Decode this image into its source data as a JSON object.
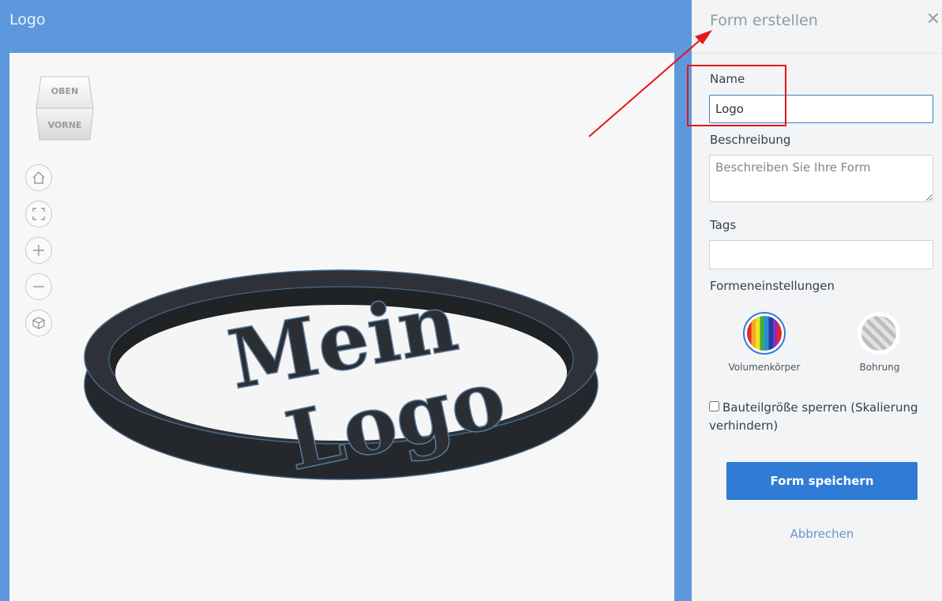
{
  "workspace": {
    "title": "Logo"
  },
  "viewcube": {
    "top_label": "OBEN",
    "front_label": "VORNE"
  },
  "view_controls": [
    {
      "name": "home-view-icon"
    },
    {
      "name": "fit-view-icon"
    },
    {
      "name": "zoom-in-icon"
    },
    {
      "name": "zoom-out-icon"
    },
    {
      "name": "perspective-icon"
    }
  ],
  "model": {
    "line1": "Mein",
    "line2": "Logo"
  },
  "panel": {
    "title": "Form erstellen",
    "close_icon": "close-icon",
    "name_label": "Name",
    "name_value": "Logo",
    "description_label": "Beschreibung",
    "description_placeholder": "Beschreiben Sie Ihre Form",
    "tags_label": "Tags",
    "tags_value": "",
    "settings_label": "Formeneinstellungen",
    "shape_options": [
      {
        "label": "Volumenkörper",
        "selected": true
      },
      {
        "label": "Bohrung",
        "selected": false
      }
    ],
    "lock_label": "Bauteilgröße sperren (Skalierung verhindern)",
    "lock_checked": false,
    "save_label": "Form speichern",
    "cancel_label": "Abbrechen"
  },
  "colors": {
    "accent": "#2f7bd5",
    "header_bg": "#5d98dc",
    "annotation": "#e8141b",
    "model": "#2a2d31"
  }
}
